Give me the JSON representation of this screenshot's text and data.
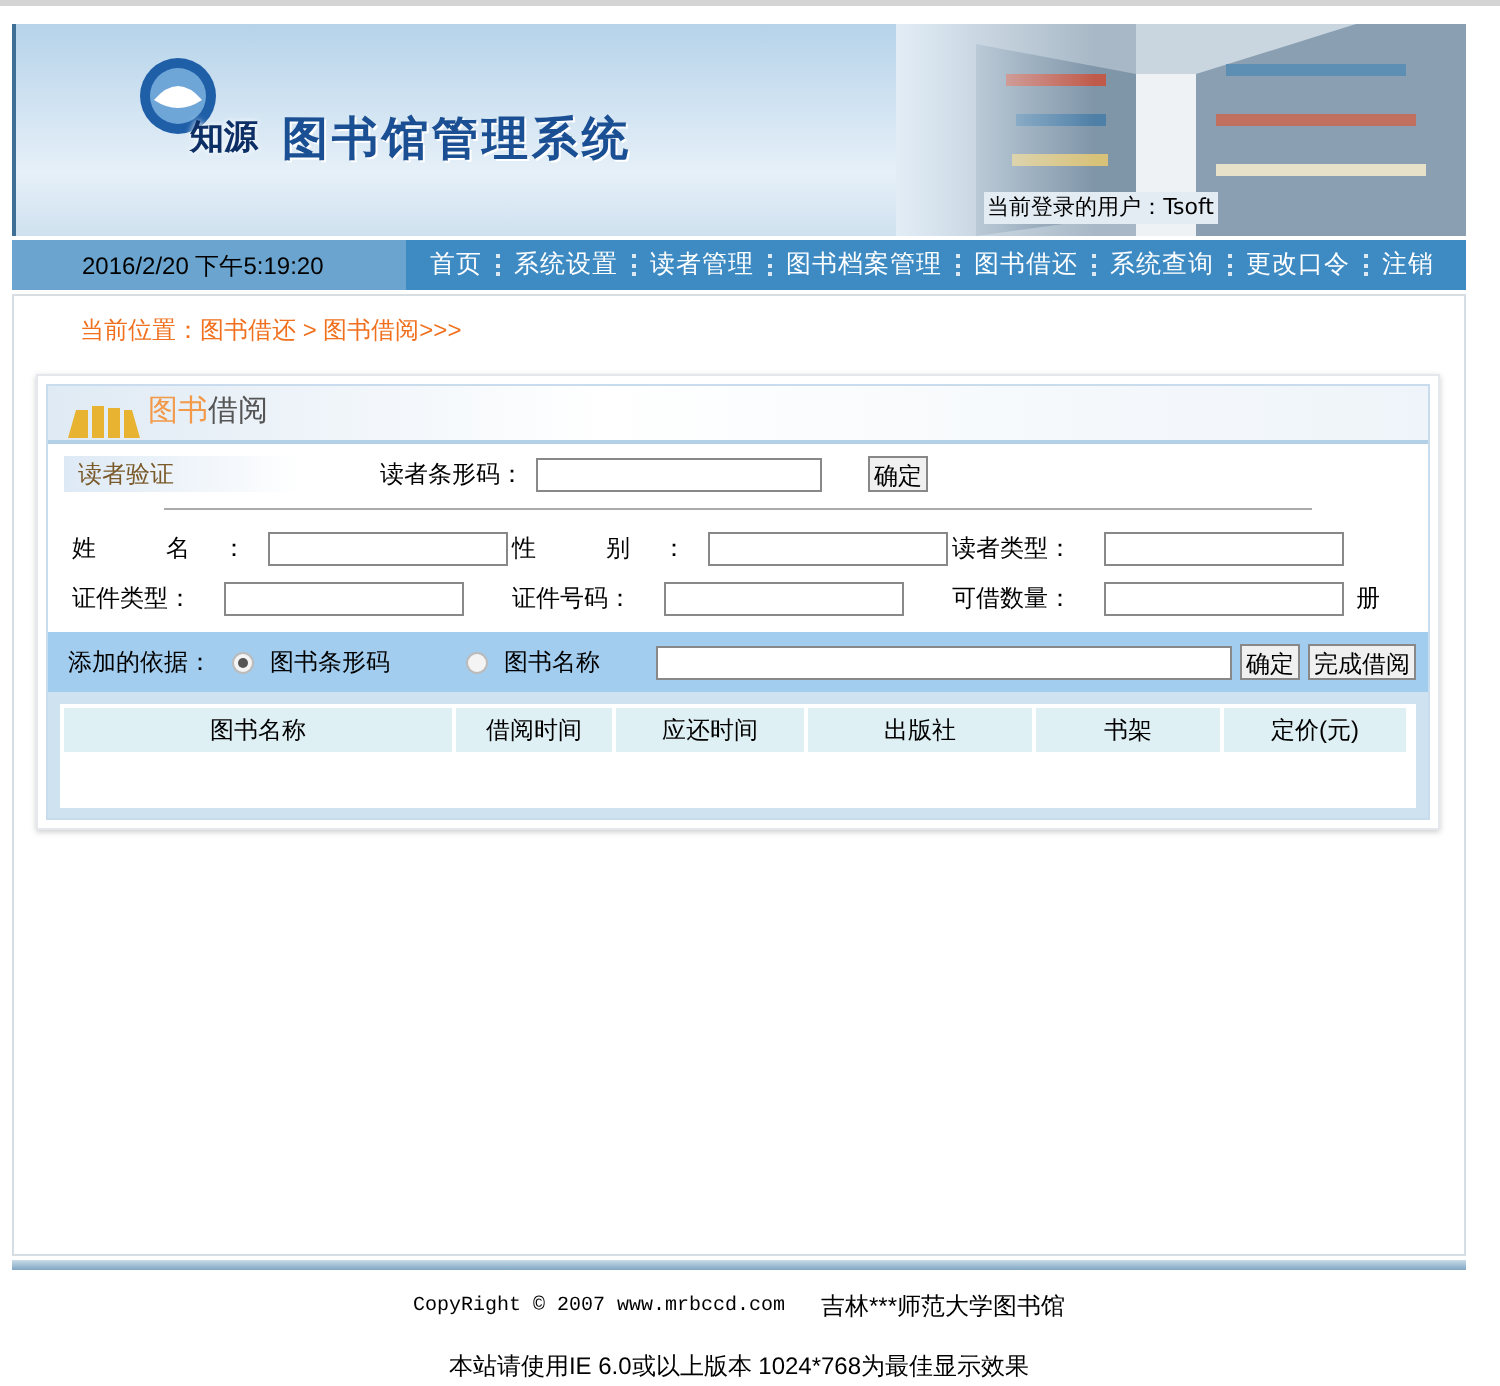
{
  "header": {
    "logo_text": "知源",
    "title": "图书馆管理系统",
    "current_user": "当前登录的用户：Tsoft"
  },
  "nav": {
    "datetime": "2016/2/20 下午5:19:20",
    "items": [
      {
        "label": "首页"
      },
      {
        "label": "系统设置"
      },
      {
        "label": "读者管理"
      },
      {
        "label": "图书档案管理"
      },
      {
        "label": "图书借还"
      },
      {
        "label": "系统查询"
      },
      {
        "label": "更改口令"
      },
      {
        "label": "注销"
      }
    ]
  },
  "breadcrumb": "当前位置：图书借还 > 图书借阅>>>",
  "panel": {
    "title": [
      "图书",
      "借阅"
    ],
    "reader_verify": {
      "section_label": "读者验证",
      "barcode_label": "读者条形码：",
      "button": "确定"
    },
    "reader_fields": [
      {
        "label": "姓 名：",
        "spaced": true
      },
      {
        "label": "性 别：",
        "spaced": true
      },
      {
        "label": "读者类型："
      },
      {
        "label": "证件类型："
      },
      {
        "label": "证件号码："
      },
      {
        "label": "可借数量：",
        "suffix": "册"
      }
    ],
    "add_by": {
      "label": "添加的依据：",
      "options": [
        {
          "label": "图书条形码",
          "selected": true
        },
        {
          "label": "图书名称",
          "selected": false
        }
      ],
      "buttons": [
        "确定",
        "完成借阅"
      ]
    },
    "table": {
      "columns": [
        "图书名称",
        "借阅时间",
        "应还时间",
        "出版社",
        "书架",
        "定价(元)"
      ]
    }
  },
  "footer": {
    "copyright": "CopyRight © 2007 www.mrbccd.com",
    "organization": "吉林***师范大学图书馆",
    "notice": "本站请使用IE 6.0或以上版本 1024*768为最佳显示效果"
  }
}
